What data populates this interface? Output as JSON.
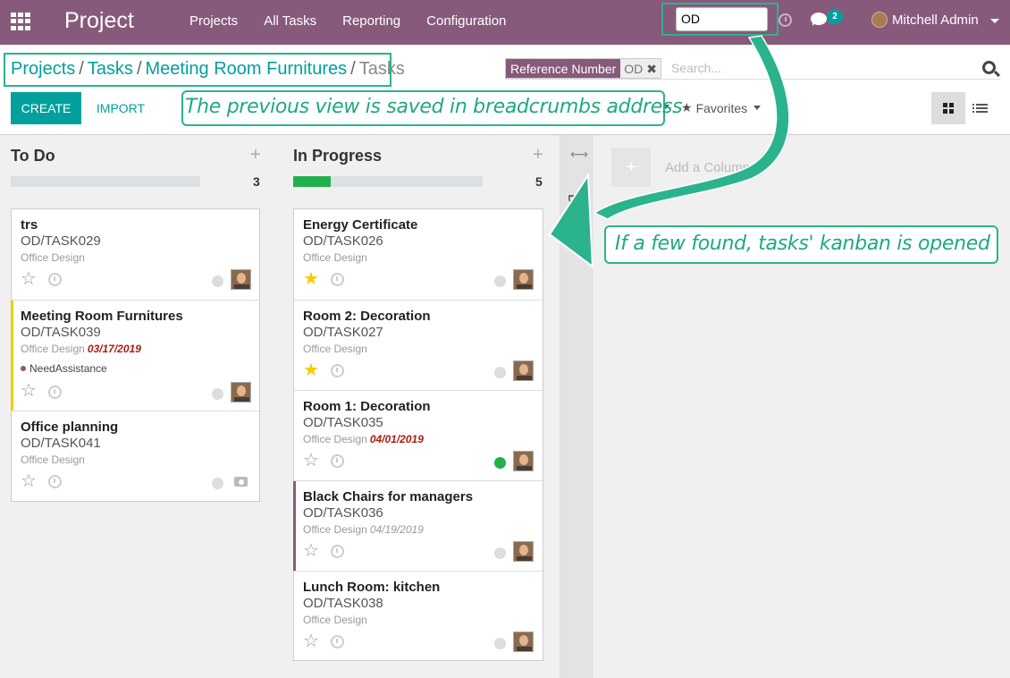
{
  "topbar": {
    "brand": "Project",
    "menu": [
      "Projects",
      "All Tasks",
      "Reporting",
      "Configuration"
    ],
    "search_value": "OD",
    "chat_count": "2",
    "user_name": "Mitchell Admin"
  },
  "breadcrumb": {
    "items": [
      "Projects",
      "Tasks",
      "Meeting Room Furnitures"
    ],
    "current": "Tasks"
  },
  "search": {
    "facet_label": "Reference Number",
    "facet_value": "OD",
    "placeholder": "Search..."
  },
  "buttons": {
    "create": "CREATE",
    "import": "IMPORT",
    "favorites": "Favorites"
  },
  "columns": [
    {
      "title": "To Do",
      "count": "3",
      "progress_fraction": 0,
      "cards": [
        {
          "name": "trs",
          "ref": "OD/TASK029",
          "project": "Office Design",
          "date": "",
          "tag": "",
          "starred": false,
          "status": "normal",
          "avatar": "user"
        },
        {
          "name": "Meeting Room Furnitures",
          "ref": "OD/TASK039",
          "project": "Office Design",
          "date": "03/17/2019",
          "date_overdue": true,
          "tag": "NeedAssistance",
          "starred": false,
          "status": "normal",
          "avatar": "user",
          "accent": "#f3cc00"
        },
        {
          "name": "Office planning",
          "ref": "OD/TASK041",
          "project": "Office Design",
          "date": "",
          "tag": "",
          "starred": false,
          "status": "normal",
          "avatar": "camera"
        }
      ]
    },
    {
      "title": "In Progress",
      "count": "5",
      "progress_fraction": 0.2,
      "cards": [
        {
          "name": "Energy Certificate",
          "ref": "OD/TASK026",
          "project": "Office Design",
          "date": "",
          "tag": "",
          "starred": true,
          "status": "normal",
          "avatar": "user"
        },
        {
          "name": "Room 2: Decoration",
          "ref": "OD/TASK027",
          "project": "Office Design",
          "date": "",
          "tag": "",
          "starred": true,
          "status": "normal",
          "avatar": "user"
        },
        {
          "name": "Room 1: Decoration",
          "ref": "OD/TASK035",
          "project": "Office Design",
          "date": "04/01/2019",
          "date_overdue": true,
          "tag": "",
          "starred": false,
          "status": "done",
          "avatar": "user"
        },
        {
          "name": "Black Chairs for managers",
          "ref": "OD/TASK036",
          "project": "Office Design",
          "date": "04/19/2019",
          "date_overdue": false,
          "tag": "",
          "starred": false,
          "status": "normal",
          "avatar": "user",
          "accent": "#875a7b"
        },
        {
          "name": "Lunch Room: kitchen",
          "ref": "OD/TASK038",
          "project": "Office Design",
          "date": "",
          "tag": "",
          "starred": false,
          "status": "normal",
          "avatar": "user"
        }
      ]
    }
  ],
  "folded_column": {
    "title": "Done (0)"
  },
  "add_column": {
    "label": "Add a Column"
  },
  "annotations": {
    "breadcrumbs_note": "The previous view is saved in breadcrumbs address",
    "kanban_note": "If a few found, tasks' kanban is opened"
  },
  "colors": {
    "topbar": "#875a7b",
    "accent": "#00a09d",
    "annotation": "#2bb38e",
    "star": "#f3cc00",
    "overdue": "#a71f12",
    "progress": "#21b04c"
  }
}
